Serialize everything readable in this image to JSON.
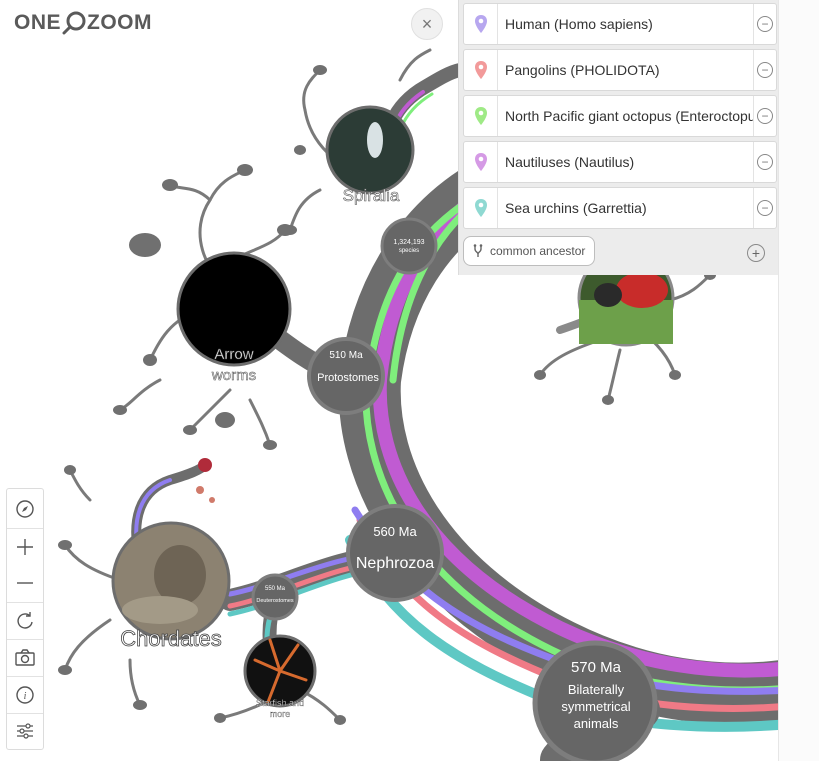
{
  "app": {
    "logo_left": "ONE",
    "logo_right": "ZOOM"
  },
  "close_label": "×",
  "pins": [
    {
      "label": "Human (Homo sapiens)",
      "color": "#b7a7ef"
    },
    {
      "label": "Pangolins (PHOLIDOTA)",
      "color": "#f29a9a"
    },
    {
      "label": "North Pacific giant octopus (Enteroctopus dofleini)",
      "color": "#9fea86"
    },
    {
      "label": "Nautiluses (Nautilus)",
      "color": "#d59ae5"
    },
    {
      "label": "Sea urchins (Garrettia)",
      "color": "#8fd9d2"
    }
  ],
  "remove_glyph": "−",
  "common_ancestor_label": "common ancestor",
  "add_glyph": "+",
  "tree": {
    "spiralia": "Spiralia",
    "species_count": "1,324,193",
    "species_word": "species",
    "arrow_worms_1": "Arrow",
    "arrow_worms_2": "worms",
    "protostomes_age": "510 Ma",
    "protostomes": "Protostomes",
    "nephrozoa_age": "560 Ma",
    "nephrozoa": "Nephrozoa",
    "deuterostomes_age": "550 Ma",
    "deuterostomes": "Deuterostomes",
    "chordates": "Chordates",
    "starfish_1": "Starfish and",
    "starfish_2": "more",
    "bilateria_age": "570 Ma",
    "bilateria_1": "Bilaterally",
    "bilateria_2": "symmetrical",
    "bilateria_3": "animals"
  },
  "colors": {
    "branch": "#6d6d6d",
    "node": "#666666",
    "purple": "#8f7df0",
    "magenta": "#c05bd2",
    "green": "#7fee7c",
    "pink": "#f07a86",
    "teal": "#5ec8c4"
  },
  "tools": [
    "compass-icon",
    "zoom-in-icon",
    "zoom-out-icon",
    "reset-icon",
    "camera-icon",
    "info-icon",
    "settings-icon"
  ]
}
